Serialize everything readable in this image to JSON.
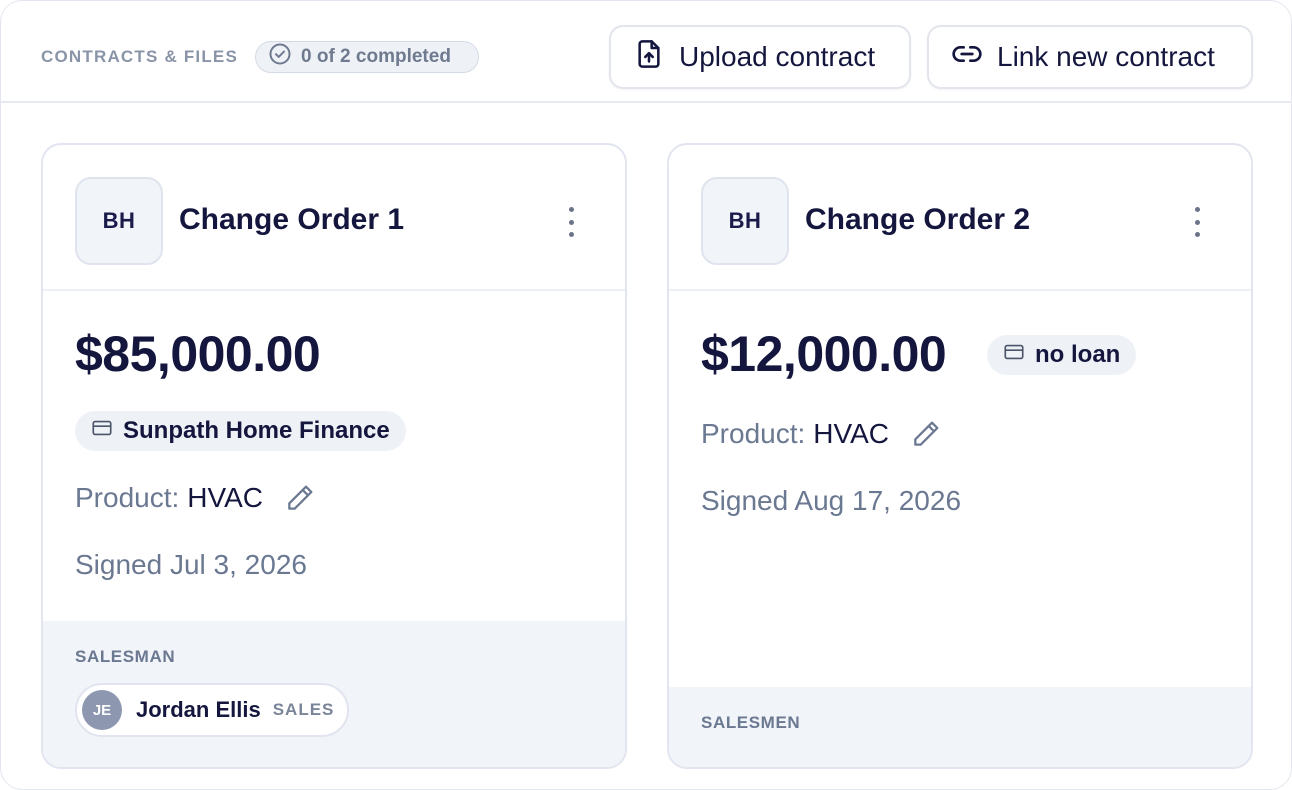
{
  "header": {
    "section_title": "CONTRACTS & FILES",
    "progress_text": "0 of 2 completed",
    "upload_label": "Upload contract",
    "link_label": "Link new contract"
  },
  "contracts": [
    {
      "initials": "BH",
      "title": "Change Order 1",
      "amount": "$85,000.00",
      "loan_chip": "Sunpath Home Finance",
      "product_label": "Product:",
      "product_value": "HVAC",
      "signed": "Signed Jul 3, 2026",
      "footer_label": "SALESMAN",
      "salesperson": {
        "initials": "JE",
        "name": "Jordan Ellis",
        "role": "SALES"
      }
    },
    {
      "initials": "BH",
      "title": "Change Order 2",
      "amount": "$12,000.00",
      "loan_chip": "no loan",
      "product_label": "Product:",
      "product_value": "HVAC",
      "signed": "Signed Aug 17, 2026",
      "footer_label": "SALESMEN"
    }
  ],
  "icons": {
    "completed": "check-circle-icon",
    "upload": "file-upload-icon",
    "link": "link-icon",
    "menu": "kebab-menu-icon",
    "loan": "credit-card-icon",
    "edit": "pencil-icon"
  },
  "colors": {
    "primary_text": "#14163e",
    "muted_text": "#6b7891",
    "chip_bg": "#eef2f7",
    "border": "#e2e5ef"
  }
}
